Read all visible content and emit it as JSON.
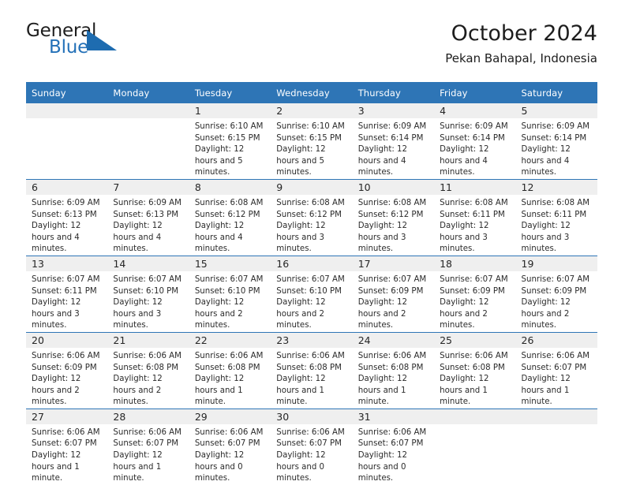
{
  "brand": {
    "word_general": "General",
    "word_blue": "Blue",
    "triangle_color": "#1e6cb0",
    "blue_text_color": "#2471b8"
  },
  "header": {
    "title": "October 2024",
    "location": "Pekan Bahapal, Indonesia"
  },
  "theme": {
    "header_bg": "#2e75b6",
    "header_text": "#ffffff",
    "daynum_bg": "#efefef",
    "row_rule": "#2e75b6",
    "body_text": "#2b2b2b"
  },
  "calendar": {
    "weekday_headers": [
      "Sunday",
      "Monday",
      "Tuesday",
      "Wednesday",
      "Thursday",
      "Friday",
      "Saturday"
    ],
    "weeks": [
      [
        {
          "day": "",
          "sunrise": "",
          "sunset": "",
          "daylight": ""
        },
        {
          "day": "",
          "sunrise": "",
          "sunset": "",
          "daylight": ""
        },
        {
          "day": "1",
          "sunrise": "Sunrise: 6:10 AM",
          "sunset": "Sunset: 6:15 PM",
          "daylight": "Daylight: 12 hours and 5 minutes."
        },
        {
          "day": "2",
          "sunrise": "Sunrise: 6:10 AM",
          "sunset": "Sunset: 6:15 PM",
          "daylight": "Daylight: 12 hours and 5 minutes."
        },
        {
          "day": "3",
          "sunrise": "Sunrise: 6:09 AM",
          "sunset": "Sunset: 6:14 PM",
          "daylight": "Daylight: 12 hours and 4 minutes."
        },
        {
          "day": "4",
          "sunrise": "Sunrise: 6:09 AM",
          "sunset": "Sunset: 6:14 PM",
          "daylight": "Daylight: 12 hours and 4 minutes."
        },
        {
          "day": "5",
          "sunrise": "Sunrise: 6:09 AM",
          "sunset": "Sunset: 6:14 PM",
          "daylight": "Daylight: 12 hours and 4 minutes."
        }
      ],
      [
        {
          "day": "6",
          "sunrise": "Sunrise: 6:09 AM",
          "sunset": "Sunset: 6:13 PM",
          "daylight": "Daylight: 12 hours and 4 minutes."
        },
        {
          "day": "7",
          "sunrise": "Sunrise: 6:09 AM",
          "sunset": "Sunset: 6:13 PM",
          "daylight": "Daylight: 12 hours and 4 minutes."
        },
        {
          "day": "8",
          "sunrise": "Sunrise: 6:08 AM",
          "sunset": "Sunset: 6:12 PM",
          "daylight": "Daylight: 12 hours and 4 minutes."
        },
        {
          "day": "9",
          "sunrise": "Sunrise: 6:08 AM",
          "sunset": "Sunset: 6:12 PM",
          "daylight": "Daylight: 12 hours and 3 minutes."
        },
        {
          "day": "10",
          "sunrise": "Sunrise: 6:08 AM",
          "sunset": "Sunset: 6:12 PM",
          "daylight": "Daylight: 12 hours and 3 minutes."
        },
        {
          "day": "11",
          "sunrise": "Sunrise: 6:08 AM",
          "sunset": "Sunset: 6:11 PM",
          "daylight": "Daylight: 12 hours and 3 minutes."
        },
        {
          "day": "12",
          "sunrise": "Sunrise: 6:08 AM",
          "sunset": "Sunset: 6:11 PM",
          "daylight": "Daylight: 12 hours and 3 minutes."
        }
      ],
      [
        {
          "day": "13",
          "sunrise": "Sunrise: 6:07 AM",
          "sunset": "Sunset: 6:11 PM",
          "daylight": "Daylight: 12 hours and 3 minutes."
        },
        {
          "day": "14",
          "sunrise": "Sunrise: 6:07 AM",
          "sunset": "Sunset: 6:10 PM",
          "daylight": "Daylight: 12 hours and 3 minutes."
        },
        {
          "day": "15",
          "sunrise": "Sunrise: 6:07 AM",
          "sunset": "Sunset: 6:10 PM",
          "daylight": "Daylight: 12 hours and 2 minutes."
        },
        {
          "day": "16",
          "sunrise": "Sunrise: 6:07 AM",
          "sunset": "Sunset: 6:10 PM",
          "daylight": "Daylight: 12 hours and 2 minutes."
        },
        {
          "day": "17",
          "sunrise": "Sunrise: 6:07 AM",
          "sunset": "Sunset: 6:09 PM",
          "daylight": "Daylight: 12 hours and 2 minutes."
        },
        {
          "day": "18",
          "sunrise": "Sunrise: 6:07 AM",
          "sunset": "Sunset: 6:09 PM",
          "daylight": "Daylight: 12 hours and 2 minutes."
        },
        {
          "day": "19",
          "sunrise": "Sunrise: 6:07 AM",
          "sunset": "Sunset: 6:09 PM",
          "daylight": "Daylight: 12 hours and 2 minutes."
        }
      ],
      [
        {
          "day": "20",
          "sunrise": "Sunrise: 6:06 AM",
          "sunset": "Sunset: 6:09 PM",
          "daylight": "Daylight: 12 hours and 2 minutes."
        },
        {
          "day": "21",
          "sunrise": "Sunrise: 6:06 AM",
          "sunset": "Sunset: 6:08 PM",
          "daylight": "Daylight: 12 hours and 2 minutes."
        },
        {
          "day": "22",
          "sunrise": "Sunrise: 6:06 AM",
          "sunset": "Sunset: 6:08 PM",
          "daylight": "Daylight: 12 hours and 1 minute."
        },
        {
          "day": "23",
          "sunrise": "Sunrise: 6:06 AM",
          "sunset": "Sunset: 6:08 PM",
          "daylight": "Daylight: 12 hours and 1 minute."
        },
        {
          "day": "24",
          "sunrise": "Sunrise: 6:06 AM",
          "sunset": "Sunset: 6:08 PM",
          "daylight": "Daylight: 12 hours and 1 minute."
        },
        {
          "day": "25",
          "sunrise": "Sunrise: 6:06 AM",
          "sunset": "Sunset: 6:08 PM",
          "daylight": "Daylight: 12 hours and 1 minute."
        },
        {
          "day": "26",
          "sunrise": "Sunrise: 6:06 AM",
          "sunset": "Sunset: 6:07 PM",
          "daylight": "Daylight: 12 hours and 1 minute."
        }
      ],
      [
        {
          "day": "27",
          "sunrise": "Sunrise: 6:06 AM",
          "sunset": "Sunset: 6:07 PM",
          "daylight": "Daylight: 12 hours and 1 minute."
        },
        {
          "day": "28",
          "sunrise": "Sunrise: 6:06 AM",
          "sunset": "Sunset: 6:07 PM",
          "daylight": "Daylight: 12 hours and 1 minute."
        },
        {
          "day": "29",
          "sunrise": "Sunrise: 6:06 AM",
          "sunset": "Sunset: 6:07 PM",
          "daylight": "Daylight: 12 hours and 0 minutes."
        },
        {
          "day": "30",
          "sunrise": "Sunrise: 6:06 AM",
          "sunset": "Sunset: 6:07 PM",
          "daylight": "Daylight: 12 hours and 0 minutes."
        },
        {
          "day": "31",
          "sunrise": "Sunrise: 6:06 AM",
          "sunset": "Sunset: 6:07 PM",
          "daylight": "Daylight: 12 hours and 0 minutes."
        },
        {
          "day": "",
          "sunrise": "",
          "sunset": "",
          "daylight": ""
        },
        {
          "day": "",
          "sunrise": "",
          "sunset": "",
          "daylight": ""
        }
      ]
    ]
  }
}
